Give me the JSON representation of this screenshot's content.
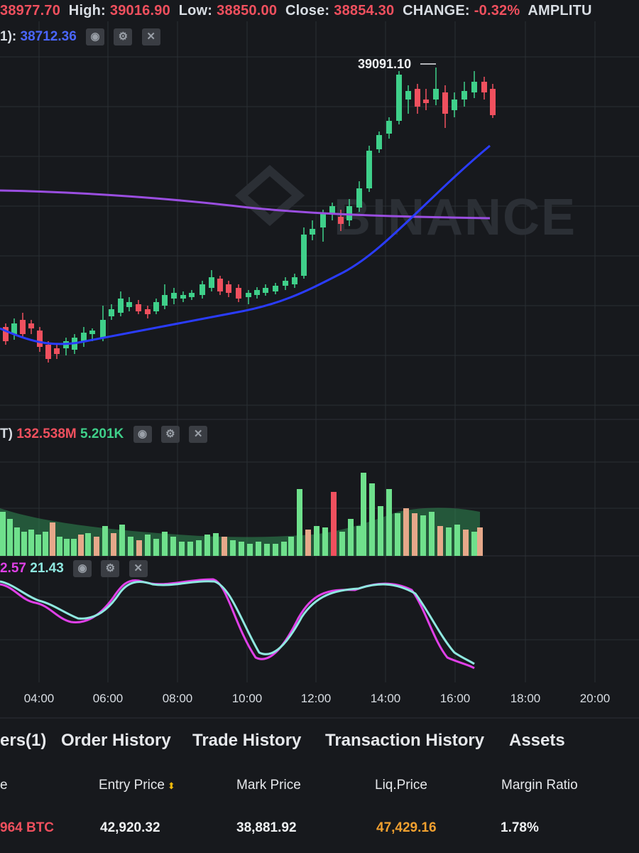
{
  "ohlc": {
    "open_value": "38977.70",
    "high_label": "High:",
    "high_value": "39016.90",
    "low_label": "Low:",
    "low_value": "38850.00",
    "close_label": "Close:",
    "close_value": "38854.30",
    "change_label": "CHANGE:",
    "change_value": "-0.32%",
    "amplitude_label": "AMPLITU"
  },
  "ma": {
    "prefix": "1):",
    "value": "38712.36"
  },
  "price_annotation": "39091.10",
  "volume": {
    "prefix": "T)",
    "value_1": "132.538M",
    "value_2": "5.201K"
  },
  "kdj": {
    "value_1": "2.57",
    "value_2": "21.43"
  },
  "time_axis": [
    "04:00",
    "06:00",
    "08:00",
    "10:00",
    "12:00",
    "14:00",
    "16:00",
    "18:00",
    "20:00"
  ],
  "tabs": [
    "ers(1)",
    "Order History",
    "Trade History",
    "Transaction History",
    "Assets"
  ],
  "table": {
    "headers": [
      "e",
      "Entry Price",
      "Mark Price",
      "Liq.Price",
      "Margin Ratio"
    ],
    "row": {
      "size": "964 BTC",
      "entry_price": "42,920.32",
      "mark_price": "38,881.92",
      "liq_price": "47,429.16",
      "margin_ratio": "1.78%"
    }
  },
  "watermark": "BINANCE",
  "colors": {
    "up": "#3fd08a",
    "down": "#f0505e",
    "ma_blue": "#2a3cff",
    "ma_purple": "#9a4ee0",
    "k_line": "#e040e8",
    "d_line": "#8fe8e0",
    "liq_price": "#f0a030"
  }
}
